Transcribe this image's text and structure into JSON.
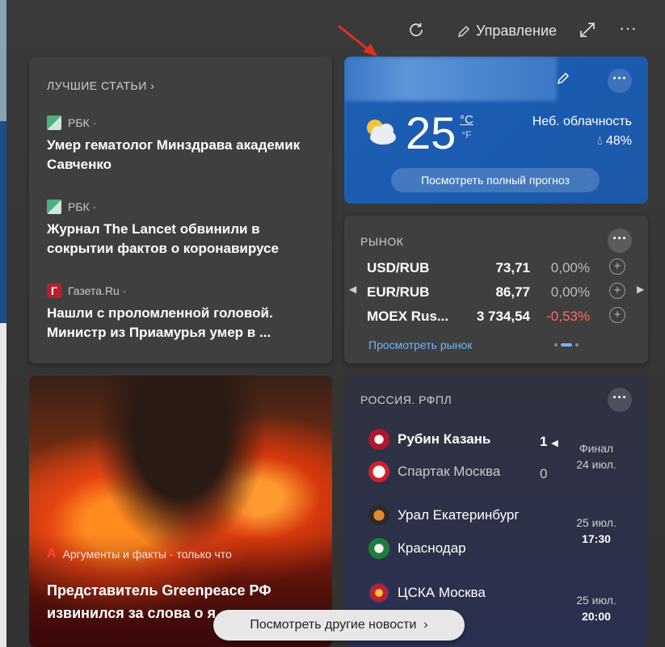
{
  "toolbar": {
    "manage_label": "Управление"
  },
  "top_stories": {
    "title": "ЛУЧШИЕ СТАТЬИ",
    "items": [
      {
        "source": "РБК ·",
        "headline": "Умер гематолог Минздрава академик Савченко"
      },
      {
        "source": "РБК ·",
        "headline": "Журнал The Lancet обвинили в сокрытии фактов о коронавирусе"
      },
      {
        "source": "Газета.Ru ·",
        "headline": "Нашли с проломленной головой. Министр из Приамурья умер в ..."
      }
    ]
  },
  "weather": {
    "temp": "25",
    "unit_c": "°C",
    "unit_f": "°F",
    "desc": "Неб. облачность",
    "humidity": "48%",
    "forecast_button": "Посмотреть полный прогноз"
  },
  "market": {
    "title": "РЫНОК",
    "rows": [
      {
        "name": "USD/RUB",
        "value": "73,71",
        "change": "0,00%"
      },
      {
        "name": "EUR/RUB",
        "value": "86,77",
        "change": "0,00%"
      },
      {
        "name": "MOEX Rus...",
        "value": "3 734,54",
        "change": "-0,53%"
      }
    ],
    "link": "Просмотреть рынок"
  },
  "sports": {
    "title": "РОССИЯ. РФПЛ",
    "matches": [
      {
        "home": "Рубин Казань",
        "away": "Спартак Москва",
        "home_score": "1",
        "away_score": "0",
        "status": "Финал",
        "date": "24 июл."
      },
      {
        "home": "Урал Екатеринбург",
        "away": "Краснодар",
        "date": "25 июл.",
        "time": "17:30"
      },
      {
        "home": "ЦСКА Москва",
        "date": "25 июл.",
        "time": "20:00"
      }
    ]
  },
  "feature": {
    "source": "Аргументы и факты · только что",
    "headline": "Представитель Greenpeace РФ извинился за слова о я"
  },
  "more_news": "Посмотреть другие новости",
  "colors": {
    "panel_bg": "#3a3a3a",
    "weather_blue": "#1e5fb4",
    "link_blue": "#6fb4ff",
    "negative_red": "#ff6a5f",
    "annotation_red": "#e0301e"
  }
}
